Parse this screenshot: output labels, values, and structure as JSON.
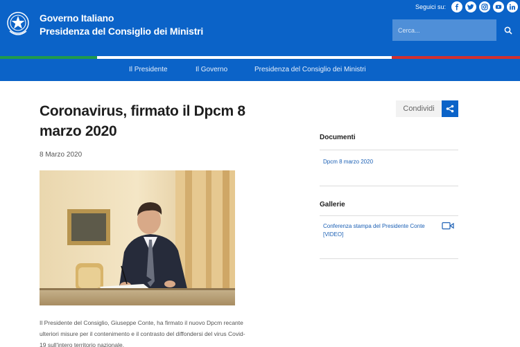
{
  "header": {
    "brand_line1": "Governo Italiano",
    "brand_line2": "Presidenza del Consiglio dei Ministri",
    "follow_label": "Seguici su:",
    "social_icons": [
      "facebook-icon",
      "twitter-icon",
      "instagram-icon",
      "youtube-icon",
      "linkedin-icon"
    ],
    "search_placeholder": "Cerca..."
  },
  "colors": {
    "brand_blue": "#0b63c8",
    "flag_green": "#1f9a4a",
    "flag_white": "#ffffff",
    "flag_red": "#d32f2f"
  },
  "nav": {
    "items": [
      "Il Presidente",
      "Il Governo",
      "Presidenza del Consiglio dei Ministri"
    ]
  },
  "article": {
    "title": "Coronavirus, firmato il Dpcm 8 marzo 2020",
    "date": "8 Marzo 2020",
    "caption": "Il Presidente del Consiglio, Giuseppe Conte, ha firmato il nuovo Dpcm recante ulteriori misure per il contenimento e il contrasto del diffondersi del virus Covid-19  sull'intero territorio nazionale."
  },
  "share": {
    "label": "Condividi"
  },
  "sidebar": {
    "documents_title": "Documenti",
    "documents": [
      "Dpcm 8 marzo 2020"
    ],
    "galleries_title": "Gallerie",
    "galleries": [
      "Conferenza stampa del Presidente Conte  [VIDEO]"
    ]
  }
}
